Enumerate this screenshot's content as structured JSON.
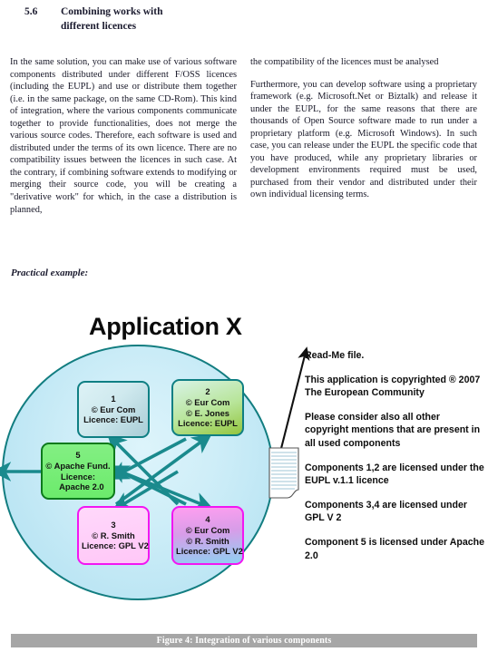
{
  "section": {
    "number": "5.6",
    "title": "Combining works with different licences"
  },
  "body": {
    "left_paragraph": "In the same solution, you can make use of various software components distributed under different F/OSS licences (including the EUPL) and use or distribute them together (i.e. in the same package, on the same CD-Rom). This kind of integration, where the various components communicate together to provide functionalities, does not merge the various source codes. Therefore, each software is used and distributed under the terms of its own licence. There are no compatibility issues between the licences in such case. At the contrary, if combining software extends to modifying or merging their source code, you will be creating a \"derivative work\" for which, in the case a distribution is planned,",
    "right_paragraph_1": "the compatibility of the licences must be analysed",
    "right_paragraph_2": "Furthermore, you can develop software using a proprietary framework (e.g. Microsoft.Net or Biztalk) and release it under the EUPL, for the same reasons that there are thousands of Open Source software made to run under a proprietary platform (e.g. Microsoft Windows). In such case, you can release under the EUPL the specific code that you have produced, while any proprietary libraries or development environments required must be used, purchased from their vendor and distributed under their own individual licensing terms."
  },
  "practical_example_label": "Practical example:",
  "figure": {
    "title": "Application X",
    "caption": "Figure 4: Integration of various components",
    "colors": {
      "circle_border": "#127d80",
      "circle_fill": "#c5eaf5",
      "arrow": "#1a8a8d",
      "box_teal_border": "#0f7f83",
      "box_green_border": "#0c7a1c",
      "box_magenta_border": "#f216f2",
      "caption_bar": "#a6a6a6"
    },
    "components": [
      {
        "id": "box1",
        "number": "1",
        "lines": [
          "© Eur Com",
          "Licence: EUPL"
        ]
      },
      {
        "id": "box2",
        "number": "2",
        "lines": [
          "© Eur Com",
          "© E. Jones",
          "Licence: EUPL"
        ]
      },
      {
        "id": "box5",
        "number": "5",
        "lines": [
          "© Apache Fund.",
          "Licence:",
          "   Apache 2.0"
        ]
      },
      {
        "id": "box3",
        "number": "3",
        "lines": [
          "© R. Smith",
          "Licence: GPL V2"
        ]
      },
      {
        "id": "box4",
        "number": "4",
        "lines": [
          "© Eur Com",
          "© R. Smith",
          "Licence: GPL V2"
        ]
      }
    ],
    "annotations": [
      "Read-Me file.",
      "This application is copyrighted ® 2007 The European Community",
      "Please consider also all other copyright mentions that are present in all used components",
      "Components 1,2 are licensed under the EUPL v.1.1 licence",
      "Components 3,4 are licensed under GPL V 2",
      "Component 5 is licensed under Apache 2.0"
    ]
  }
}
